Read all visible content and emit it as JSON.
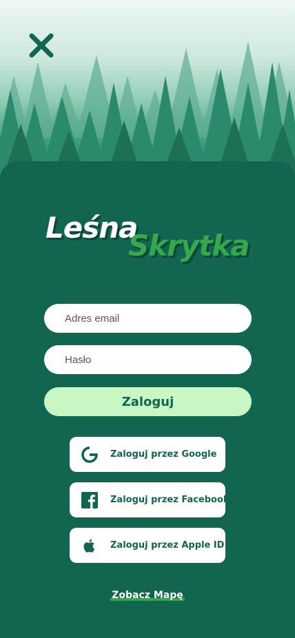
{
  "header": {
    "close_icon": "close-icon"
  },
  "logo": {
    "part1": "Leśna",
    "part2": "Skrytka"
  },
  "form": {
    "email_placeholder": "Adres email",
    "password_placeholder": "Hasło",
    "login_label": "Zaloguj"
  },
  "social": {
    "google_label": "Zaloguj przez Google",
    "facebook_label": "Zaloguj przez Facebook",
    "apple_label": "Zaloguj przez Apple ID"
  },
  "footer": {
    "map_link": "Zobacz Mapę"
  },
  "colors": {
    "background": "#12654f",
    "accent_green": "#35a84e",
    "login_button": "#c9f7c4"
  }
}
